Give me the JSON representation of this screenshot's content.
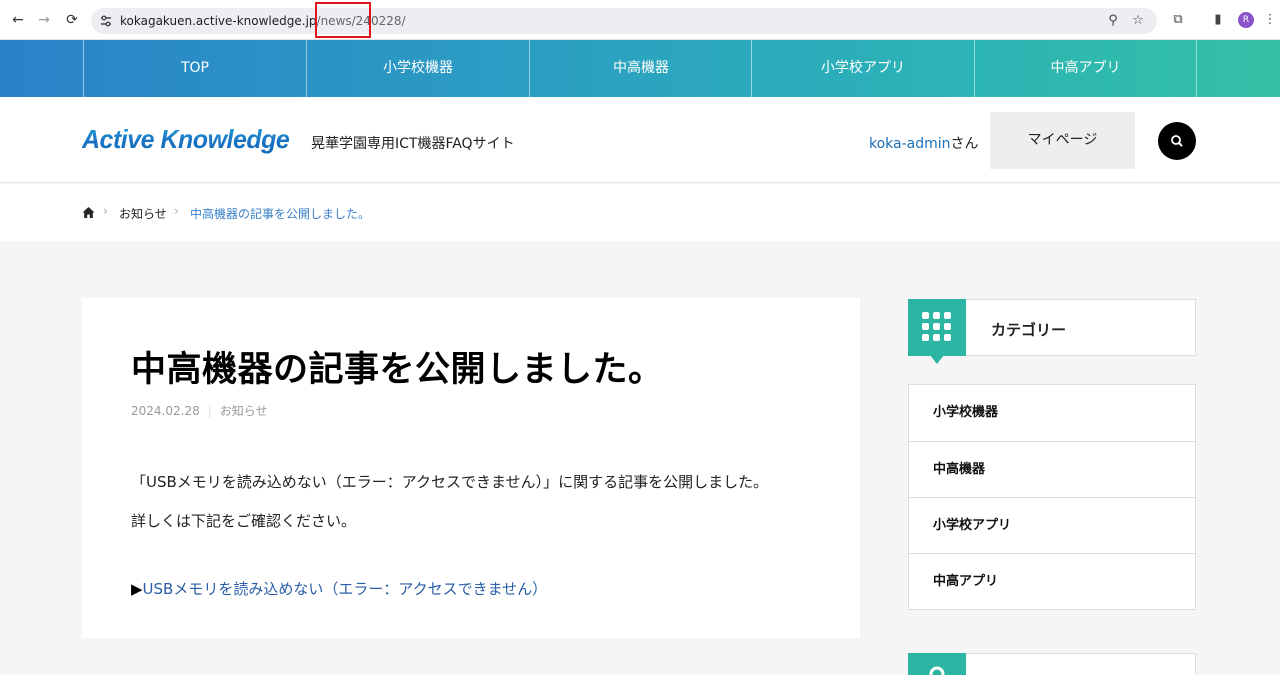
{
  "browser": {
    "url_host": "kokagakuen.active-knowledge.jp",
    "url_path_dim": "/news/",
    "url_path_id": "240228/",
    "profile_initial": "R",
    "highlight_color": "#e0141e"
  },
  "gnav": {
    "items": [
      "TOP",
      "小学校機器",
      "中高機器",
      "小学校アプリ",
      "中高アプリ"
    ]
  },
  "header": {
    "logo": "Active Knowledge",
    "tagline": "晃華学園専用ICT機器FAQサイト",
    "user_name": "koka-admin",
    "user_suffix": "さん",
    "mypage_label": "マイページ",
    "search_icon": "search-icon"
  },
  "breadcrumb": {
    "home_icon": "home-icon",
    "items": [
      "お知らせ",
      "中高機器の記事を公開しました。"
    ]
  },
  "article": {
    "title": "中高機器の記事を公開しました。",
    "date": "2024.02.28",
    "category": "お知らせ",
    "body": [
      "「USBメモリを読み込めない（エラー：アクセスできません）」に関する記事を公開しました。",
      "詳しくは下記をご確認ください。"
    ],
    "link_marker": "▶",
    "link_text": "USBメモリを読み込めない（エラー：アクセスできません）"
  },
  "sidebar": {
    "heading": "カテゴリー",
    "categories": [
      "小学校機器",
      "中高機器",
      "小学校アプリ",
      "中高アプリ"
    ],
    "accent": "#2cb5a2"
  }
}
